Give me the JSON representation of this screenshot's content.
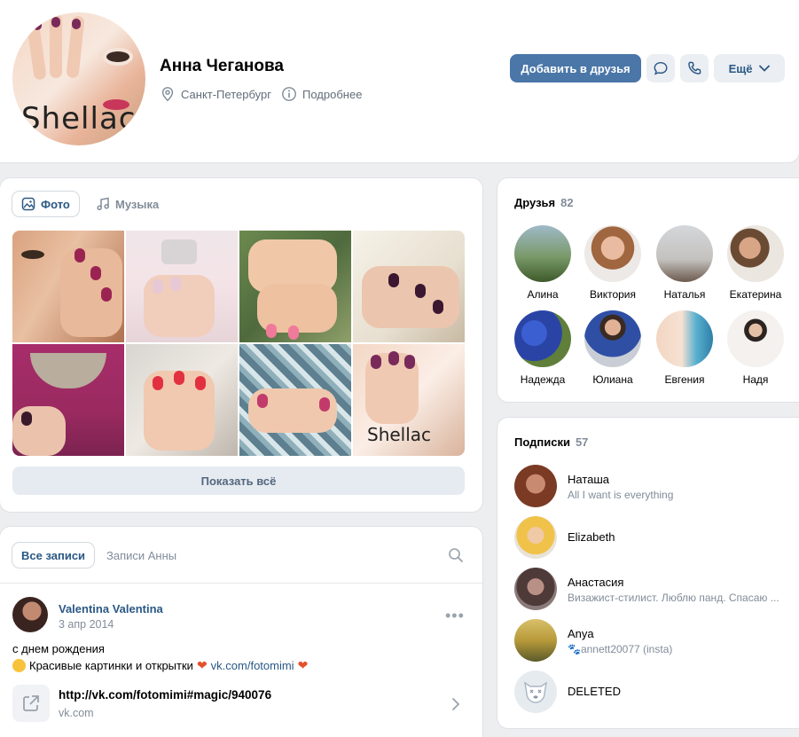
{
  "profile": {
    "name": "Анна Чеганова",
    "city": "Санкт-Петербург",
    "details": "Подробнее",
    "avatar_text": "Shellac",
    "add_friend": "Добавить в друзья",
    "more": "Ещё"
  },
  "photos": {
    "tab_photos": "Фото",
    "tab_music": "Музыка",
    "tile_text": "Shellac",
    "show_all": "Показать всё"
  },
  "posts": {
    "tab_all": "Все записи",
    "tab_own": "Записи Анны",
    "author": "Valentina Valentina",
    "date": "3 апр 2014",
    "text_line1": "с днем рождения",
    "text_line2": "Красивые картинки и открытки",
    "text_link": "vk.com/fotomimi",
    "attachment_url": "http://vk.com/fotomimi#magic/940076",
    "attachment_domain": "vk.com"
  },
  "friends": {
    "title": "Друзья",
    "count": "82",
    "items": [
      {
        "name": "Алина"
      },
      {
        "name": "Виктория"
      },
      {
        "name": "Наталья"
      },
      {
        "name": "Екатерина"
      },
      {
        "name": "Надежда"
      },
      {
        "name": "Юлиана"
      },
      {
        "name": "Евгения"
      },
      {
        "name": "Надя"
      }
    ]
  },
  "subscriptions": {
    "title": "Подписки",
    "count": "57",
    "items": [
      {
        "name": "Наташа",
        "status": "All I want is everything"
      },
      {
        "name": "Elizabeth",
        "status": ""
      },
      {
        "name": "Анастасия",
        "status": "Визажист-стилист. Люблю панд. Спасаю ..."
      },
      {
        "name": "Anya",
        "status": "annett20077 (insta)"
      },
      {
        "name": "DELETED",
        "status": ""
      }
    ]
  },
  "colors": {
    "accent": "#4a76a8",
    "link": "#2a5885",
    "muted": "#818c99",
    "background": "#edeef0"
  }
}
